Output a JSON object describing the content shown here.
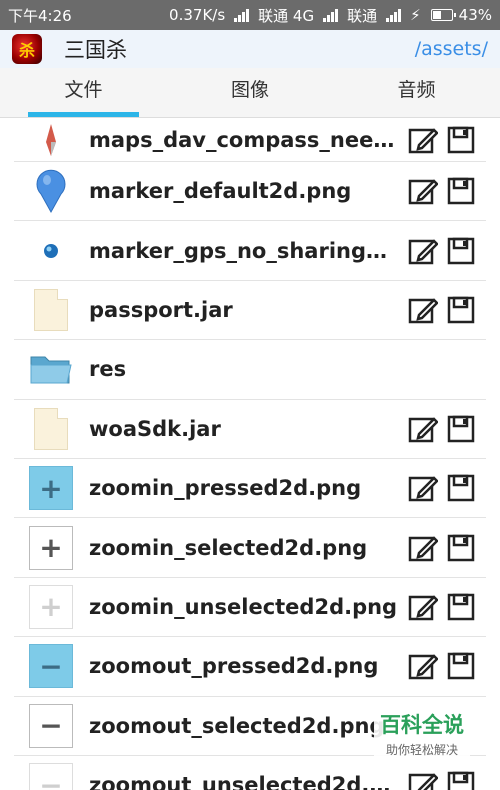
{
  "statusbar": {
    "time": "下午4:26",
    "speed": "0.37K/s",
    "carrier1": "联通 4G",
    "carrier2": "联通",
    "battery": "43%"
  },
  "appbar": {
    "logo_char": "杀",
    "title": "三国杀",
    "path": "/assets/"
  },
  "tabs": [
    {
      "label": "文件",
      "active": true
    },
    {
      "label": "图像",
      "active": false
    },
    {
      "label": "音频",
      "active": false
    }
  ],
  "files": [
    {
      "name": "maps_dav_compass_need..",
      "icon": "compass-needle-icon",
      "actions": true
    },
    {
      "name": "marker_default2d.png",
      "icon": "map-marker-icon",
      "actions": true
    },
    {
      "name": "marker_gps_no_sharing2d..",
      "icon": "gps-dot-icon",
      "actions": true
    },
    {
      "name": "passport.jar",
      "icon": "jar-file-icon",
      "actions": true
    },
    {
      "name": "res",
      "icon": "folder-icon",
      "actions": false
    },
    {
      "name": "woaSdk.jar",
      "icon": "jar-file-icon",
      "actions": true
    },
    {
      "name": "zoomin_pressed2d.png",
      "icon": "zoomin-pressed-icon",
      "actions": true
    },
    {
      "name": "zoomin_selected2d.png",
      "icon": "zoomin-selected-icon",
      "actions": true
    },
    {
      "name": "zoomin_unselected2d.png",
      "icon": "zoomin-unselected-icon",
      "actions": true
    },
    {
      "name": "zoomout_pressed2d.png",
      "icon": "zoomout-pressed-icon",
      "actions": true
    },
    {
      "name": "zoomout_selected2d.png",
      "icon": "zoomout-selected-icon",
      "actions": true
    },
    {
      "name": "zoomout_unselected2d.png",
      "icon": "zoomout-unselected-icon",
      "actions": true
    }
  ],
  "watermark": {
    "title": "百科全说",
    "subtitle": "助你轻松解决"
  },
  "colors": {
    "accent": "#2cb5e8",
    "path": "#3a8ee6",
    "statusbar": "#6b6b6b"
  }
}
